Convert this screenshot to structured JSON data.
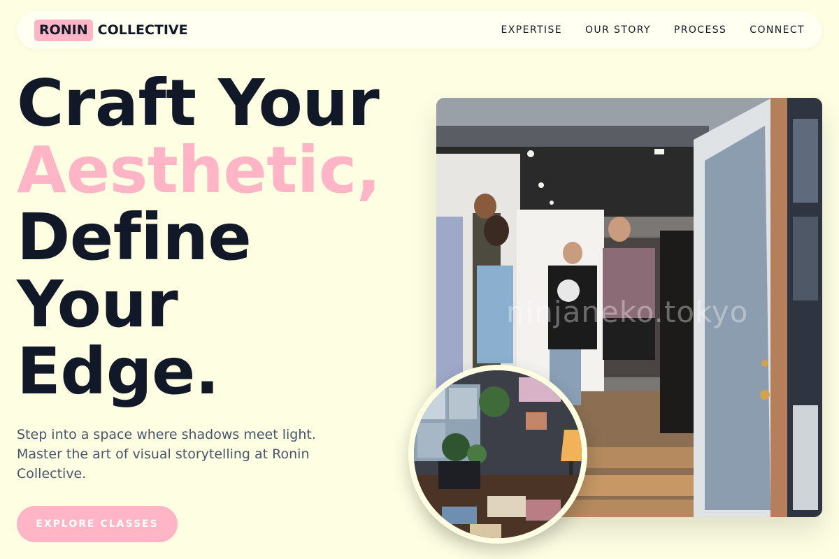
{
  "header": {
    "logo_mark": "RONIN",
    "logo_word": "COLLECTIVE",
    "nav": [
      {
        "label": "EXPERTISE"
      },
      {
        "label": "OUR STORY"
      },
      {
        "label": "PROCESS"
      },
      {
        "label": "CONNECT"
      }
    ]
  },
  "hero": {
    "headline": {
      "line1": "Craft Your",
      "line2": "Aesthetic,",
      "line3": "Define",
      "line4": "Your",
      "line5": "Edge."
    },
    "subtext": "Step into a space where shadows meet light. Master the art of visual storytelling at Ronin Collective.",
    "cta_label": "EXPLORE CLASSES"
  },
  "media": {
    "main_photo_watermark": "ninjaneko.tokyo",
    "main_photo_subject": "gallery-crowd-photo",
    "inset_photo_subject": "studio-desk-photo"
  },
  "colors": {
    "background": "#fefee3",
    "accent": "#ffb5c5",
    "text": "#111827",
    "muted": "#475569"
  }
}
